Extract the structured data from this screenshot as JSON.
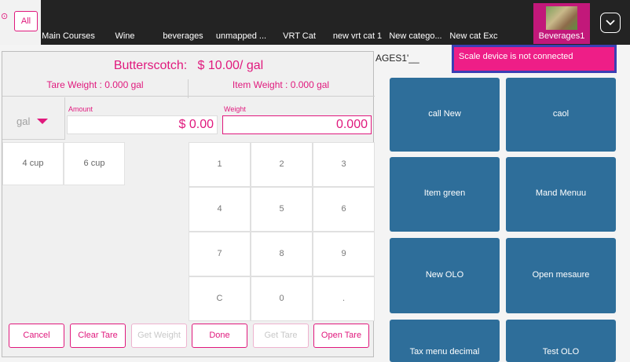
{
  "topbar": {
    "all_label": "All",
    "categories": [
      "Main Courses",
      "Wine",
      "beverages",
      "unmapped ...",
      "VRT Cat",
      "new vrt cat 1",
      "New catego...",
      "New cat Exc"
    ],
    "active_category": "Beverages1",
    "menu_icon": "chevron-down-icon"
  },
  "grid": {
    "title": "AGES1'__",
    "alert": "Scale device is not connected",
    "tiles": [
      "call New",
      "caol",
      "Item green",
      "Mand Menuu",
      "New OLO",
      "Open mesaure",
      "Tax menu decimal",
      "Test OLO"
    ]
  },
  "dialog": {
    "item_name": "Butterscotch:",
    "price": "$ 10.00/ gal",
    "tare_weight": "Tare Weight : 0.000 gal",
    "item_weight": "Item Weight : 0.000 gal",
    "unit": "gal",
    "amount_label": "Amount",
    "amount_value": "$ 0.00",
    "weight_label": "Weight",
    "weight_value": "0.000",
    "quick_units": [
      "4 cup",
      "6 cup"
    ],
    "keys": [
      "1",
      "2",
      "3",
      "4",
      "5",
      "6",
      "7",
      "8",
      "9",
      "C",
      "0",
      "."
    ],
    "buttons": {
      "cancel": "Cancel",
      "clear_tare": "Clear Tare",
      "get_weight": "Get Weight",
      "done": "Done",
      "get_tare": "Get Tare",
      "open_tare": "Open Tare"
    }
  }
}
